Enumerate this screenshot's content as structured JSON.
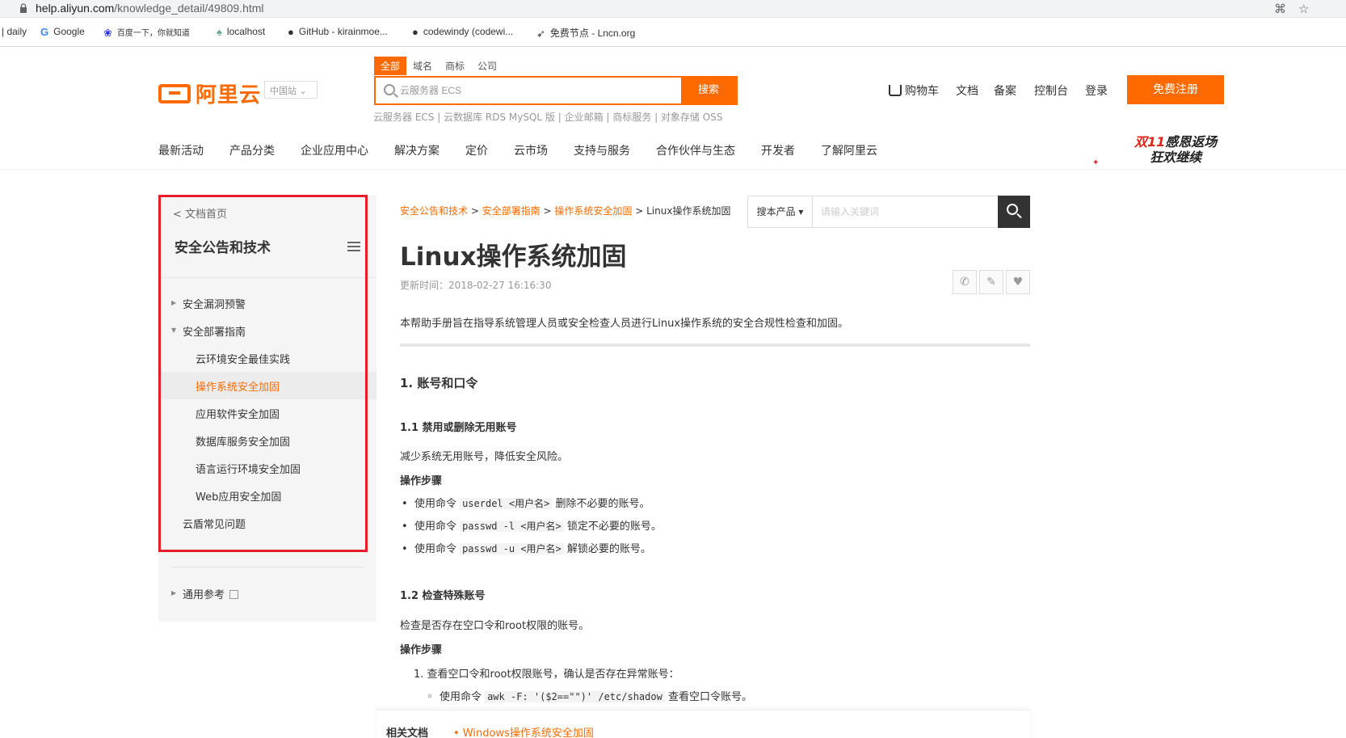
{
  "browser": {
    "url_host": "help.aliyun.com",
    "url_path": "/knowledge_detail/49809.html",
    "bookmarks": [
      {
        "label": "daily",
        "icon": ""
      },
      {
        "label": "Google",
        "icon": "google-icon"
      },
      {
        "label": "百度一下，你就知道",
        "icon": "baidu-icon"
      },
      {
        "label": "localhost",
        "icon": "leaf-icon"
      },
      {
        "label": "GitHub - kirainmoe...",
        "icon": "github-icon"
      },
      {
        "label": "codewindy (codewi...",
        "icon": "github-icon"
      },
      {
        "label": "免费节点 - Lncn.org",
        "icon": "paper-plane-icon"
      }
    ]
  },
  "header": {
    "brand": "阿里云",
    "region": "中国站",
    "search_tabs": [
      "全部",
      "域名",
      "商标",
      "公司"
    ],
    "search_placeholder": "云服务器 ECS",
    "search_button": "搜索",
    "hot_links": "云服务器 ECS | 云数据库 RDS MySQL 版 | 企业邮箱 | 商标服务 | 对象存储 OSS",
    "top_links": [
      "购物车",
      "文档",
      "备案",
      "控制台",
      "登录"
    ],
    "register": "免费注册",
    "main_nav": [
      "最新活动",
      "产品分类",
      "企业应用中心",
      "解决方案",
      "定价",
      "云市场",
      "支持与服务",
      "合作伙伴与生态",
      "开发者",
      "了解阿里云"
    ],
    "promo": {
      "line1_hl": "双11",
      "line1": "感恩返场",
      "line2": "狂欢继续"
    }
  },
  "sidebar": {
    "home": "< 文档首页",
    "title": "安全公告和技术",
    "items": [
      "安全漏洞预警",
      "安全部署指南",
      "云环境安全最佳实践",
      "操作系统安全加固",
      "应用软件安全加固",
      "数据库服务安全加固",
      "语言运行环境安全加固",
      "Web应用安全加固",
      "云盾常见问题",
      "通用参考"
    ]
  },
  "content": {
    "breadcrumb": [
      "安全公告和技术",
      "安全部署指南",
      "操作系统安全加固",
      "Linux操作系统加固"
    ],
    "search_product": "搜本产品",
    "search_placeholder": "请输入关键词",
    "title": "Linux操作系统加固",
    "updated": "更新时间：2018-02-27 16:16:30",
    "intro": "本帮助手册旨在指导系统管理人员或安全检查人员进行Linux操作系统的安全合规性检查和加固。",
    "sec1": "1. 账号和口令",
    "sec1_1": "1.1 禁用或删除无用账号",
    "sec1_1_desc": "减少系统无用账号，降低安全风险。",
    "steps_label": "操作步骤",
    "list1": [
      {
        "pre": "使用命令 ",
        "code": "userdel <用户名>",
        "post": " 删除不必要的账号。"
      },
      {
        "pre": "使用命令 ",
        "code": "passwd -l <用户名>",
        "post": " 锁定不必要的账号。"
      },
      {
        "pre": "使用命令 ",
        "code": "passwd -u <用户名>",
        "post": " 解锁必要的账号。"
      }
    ],
    "sec1_2": "1.2 检查特殊账号",
    "sec1_2_desc": "检查是否存在空口令和root权限的账号。",
    "ol1": "1. 查看空口令和root权限账号，确认是否存在异常账号：",
    "sub1": {
      "pre": "使用命令 ",
      "code": "awk -F: '($2==\"\")' /etc/shadow",
      "post": " 查看空口令账号。"
    },
    "related_label": "相关文档",
    "related_link": "• Windows操作系统安全加固"
  }
}
